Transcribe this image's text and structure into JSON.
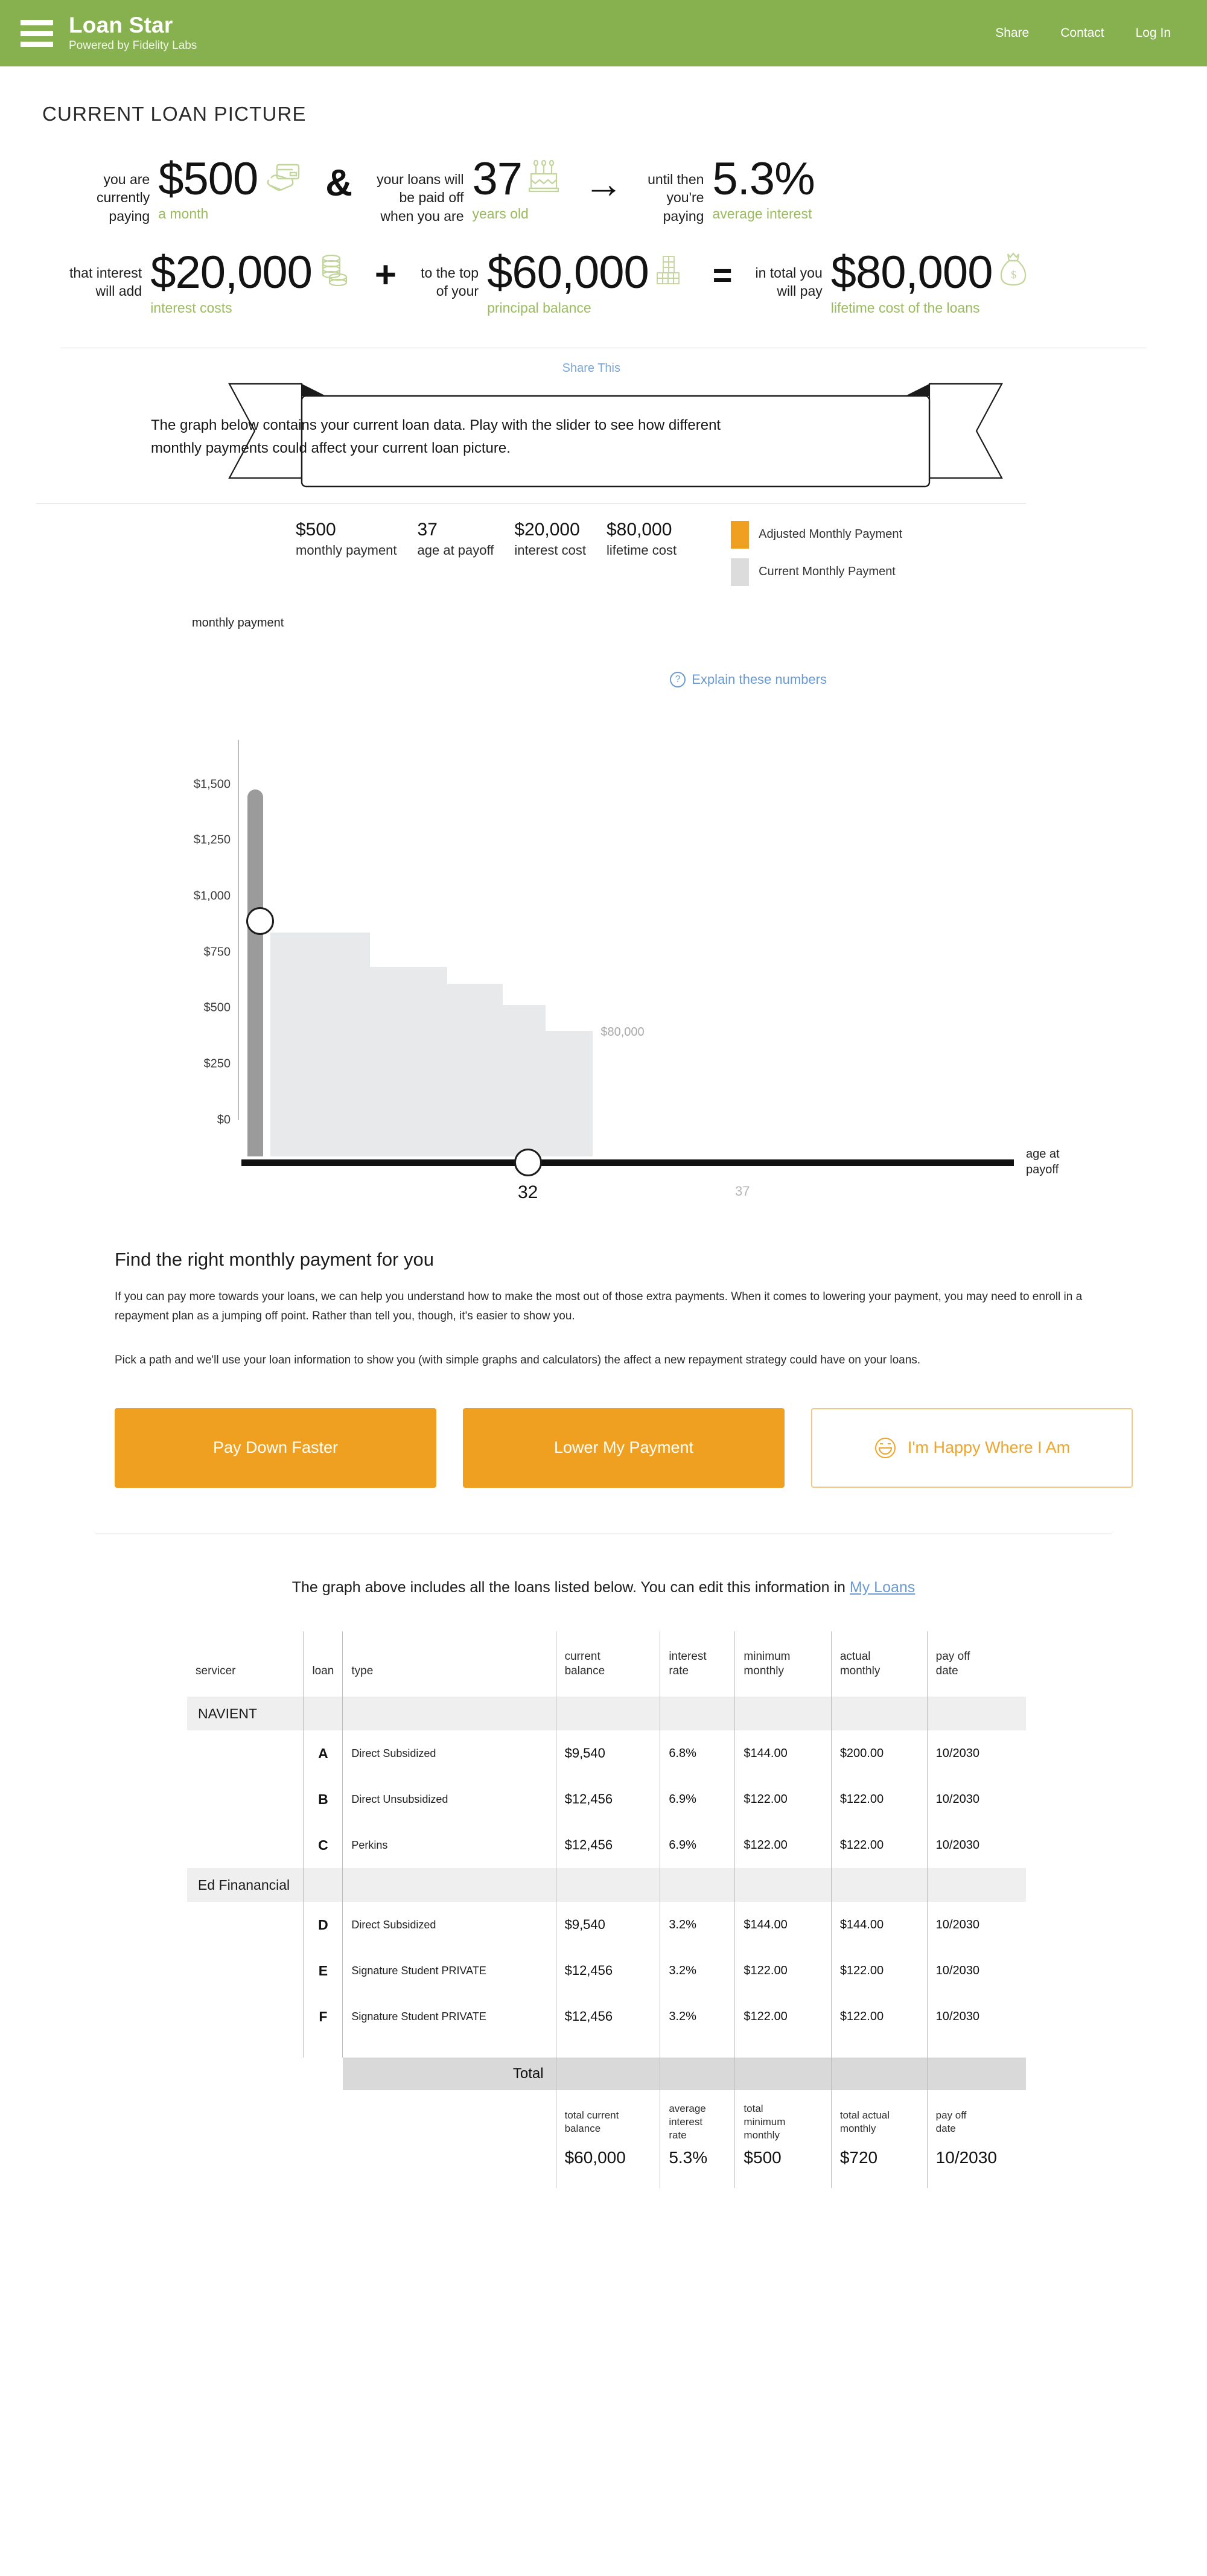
{
  "header": {
    "menu_icon": "hamburger-icon",
    "brand_title": "Loan Star",
    "brand_subtitle": "Powered by Fidelity Labs",
    "nav": [
      {
        "label": "Share"
      },
      {
        "label": "Contact"
      },
      {
        "label": "Log In"
      }
    ]
  },
  "page": {
    "section_title": "CURRENT LOAN PICTURE",
    "share_this": "Share This"
  },
  "hero": {
    "row1": [
      {
        "lead": "you are\ncurrently\npaying",
        "value": "$500",
        "label": "a month",
        "icon": "hand-card-icon"
      },
      {
        "op": "&"
      },
      {
        "lead": "your loans will\nbe paid off\nwhen you are",
        "value": "37",
        "label": "years old",
        "icon": "birthday-cake-icon"
      },
      {
        "op": "→"
      },
      {
        "lead": "until then\nyou're\npaying",
        "value": "5.3%",
        "label": "average interest",
        "icon": "none"
      }
    ],
    "row2": [
      {
        "lead": "that interest\nwill add",
        "value": "$20,000",
        "label": "interest costs",
        "icon": "coins-icon"
      },
      {
        "op": "+"
      },
      {
        "lead": "to the top\nof your",
        "value": "$60,000",
        "label": "principal balance",
        "icon": "money-stack-icon"
      },
      {
        "op": "="
      },
      {
        "lead": "in total you\nwill pay",
        "value": "$80,000",
        "label": "lifetime cost of the loans",
        "icon": "money-bag-icon"
      }
    ]
  },
  "banner": {
    "text": "The graph below contains your current loan data. Play with the slider to see how different monthly payments could affect your current loan picture."
  },
  "ministats": [
    {
      "value": "$500",
      "label": "monthly payment"
    },
    {
      "value": "37",
      "label": "age at payoff"
    },
    {
      "value": "$20,000",
      "label": "interest cost"
    },
    {
      "value": "$80,000",
      "label": "lifetime cost"
    }
  ],
  "legend": [
    {
      "label": "Adjusted Monthly Payment",
      "color": "#f0a020"
    },
    {
      "label": "Current Monthly Payment",
      "color": "#dcdcdc"
    }
  ],
  "explain_link": "Explain these numbers",
  "chart_data": {
    "type": "area",
    "title": "",
    "xlabel": "age at payoff",
    "ylabel": "monthly payment",
    "ylim": [
      0,
      1700
    ],
    "xlim": [
      26,
      44
    ],
    "grid": false,
    "ytick_labels": [
      "$0",
      "$250",
      "$500",
      "$750",
      "$1,000",
      "$1,250",
      "$1,500"
    ],
    "ytick_values": [
      0,
      250,
      500,
      750,
      1000,
      1250,
      1500
    ],
    "xtick_labels": [
      "32",
      "37"
    ],
    "xtick_values": [
      32,
      37
    ],
    "series": [
      {
        "name": "Current Monthly Payment",
        "color": "#e8e9ea",
        "type": "step-area",
        "annotation": "$80,000",
        "steps": [
          {
            "x_start": 27.0,
            "x_end": 29.3,
            "value": 1000
          },
          {
            "x_start": 29.3,
            "x_end": 31.1,
            "value": 845
          },
          {
            "x_start": 31.1,
            "x_end": 32.4,
            "value": 770
          },
          {
            "x_start": 32.4,
            "x_end": 33.4,
            "value": 675
          },
          {
            "x_start": 33.4,
            "x_end": 34.5,
            "value": 560
          }
        ]
      },
      {
        "name": "Adjusted Monthly Payment",
        "color": "#9b9b9b",
        "type": "vertical-slider",
        "track_top": 1640,
        "handle_value": 1050
      }
    ],
    "x_slider_handle": 32,
    "x_ghost_tick": 37
  },
  "find_section": {
    "heading": "Find the right monthly payment for you",
    "paragraph1": "If you can pay more towards your loans, we can help you understand how to make the most out of those extra payments. When it comes to lowering your payment, you may need to enroll in a repayment plan as a jumping off point. Rather than tell you, though, it's easier to show you.",
    "paragraph2": "Pick a path and we'll use your loan information to show you (with simple graphs and calculators) the affect a new repayment strategy could have on your loans."
  },
  "ctas": [
    {
      "label": "Pay Down Faster",
      "style": "solid"
    },
    {
      "label": "Lower My Payment",
      "style": "solid"
    },
    {
      "label": "I'm Happy  Where I Am",
      "style": "ghost",
      "icon": "smiley-icon"
    }
  ],
  "table_intro": {
    "text": "The graph above includes all the loans listed below. You can edit this information in ",
    "link": "My Loans"
  },
  "loans_table": {
    "headers": {
      "servicer": "servicer",
      "loan": "loan",
      "type": "type",
      "current_balance": "current\nbalance",
      "interest_rate": "interest\nrate",
      "minimum_monthly": "minimum\nmonthly",
      "actual_monthly": "actual\nmonthly",
      "payoff_date": "pay off\ndate"
    },
    "groups": [
      {
        "servicer": "NAVIENT",
        "rows": [
          {
            "loan": "A",
            "type": "Direct Subsidized",
            "current_balance": "$9,540",
            "interest_rate": "6.8%",
            "minimum_monthly": "$144.00",
            "actual_monthly": "$200.00",
            "payoff_date": "10/2030"
          },
          {
            "loan": "B",
            "type": "Direct Unsubsidized",
            "current_balance": "$12,456",
            "interest_rate": "6.9%",
            "minimum_monthly": "$122.00",
            "actual_monthly": "$122.00",
            "payoff_date": "10/2030"
          },
          {
            "loan": "C",
            "type": "Perkins",
            "current_balance": "$12,456",
            "interest_rate": "6.9%",
            "minimum_monthly": "$122.00",
            "actual_monthly": "$122.00",
            "payoff_date": "10/2030"
          }
        ]
      },
      {
        "servicer": "Ed Finanancial",
        "rows": [
          {
            "loan": "D",
            "type": "Direct Subsidized",
            "current_balance": "$9,540",
            "interest_rate": "3.2%",
            "minimum_monthly": "$144.00",
            "actual_monthly": "$144.00",
            "payoff_date": "10/2030"
          },
          {
            "loan": "E",
            "type": "Signature Student PRIVATE",
            "current_balance": "$12,456",
            "interest_rate": "3.2%",
            "minimum_monthly": "$122.00",
            "actual_monthly": "$122.00",
            "payoff_date": "10/2030"
          },
          {
            "loan": "F",
            "type": "Signature Student PRIVATE",
            "current_balance": "$12,456",
            "interest_rate": "3.2%",
            "minimum_monthly": "$122.00",
            "actual_monthly": "$122.00",
            "payoff_date": "10/2030"
          }
        ]
      }
    ],
    "total": {
      "label": "Total",
      "headers": {
        "current_balance": "total current\nbalance",
        "interest_rate": "average\ninterest\nrate",
        "minimum_monthly": "total\nminimum\nmonthly",
        "actual_monthly": "total actual\nmonthly",
        "payoff_date": "pay off\ndate"
      },
      "values": {
        "current_balance": "$60,000",
        "interest_rate": "5.3%",
        "minimum_monthly": "$500",
        "actual_monthly": "$720",
        "payoff_date": "10/2030"
      }
    }
  }
}
